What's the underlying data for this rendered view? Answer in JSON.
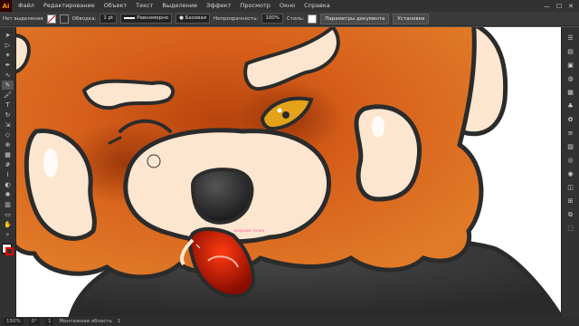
{
  "app": {
    "logo": "Ai"
  },
  "menubar": {
    "items": [
      "Файл",
      "Редактирование",
      "Объект",
      "Текст",
      "Выделение",
      "Эффект",
      "Просмотр",
      "Окно",
      "Справка"
    ],
    "window_controls": [
      "minimize-icon",
      "maximize-icon",
      "close-icon"
    ]
  },
  "controlbar": {
    "selection_label": "Нет выделения",
    "stroke_label": "Обводка:",
    "stroke_weight": "1 pt",
    "profile": "Равномерно",
    "brush": "Базовая",
    "opacity_label": "Непрозрачность:",
    "opacity_value": "100%",
    "style_label": "Стиль:",
    "doc_settings_button": "Параметры документа",
    "preferences_button": "Установки"
  },
  "canvas": {
    "cursor_hint": "якорная точка",
    "colors": {
      "fur": "#d85f18",
      "muzzle": "#fde6cf",
      "outline": "#2b2b2b",
      "eye": "#e3a21a",
      "mouth": "#cc1a00",
      "body": "#3a3a3a"
    }
  },
  "toolbar": {
    "tools": [
      "selection-tool",
      "direct-selection-tool",
      "magic-wand-tool",
      "pen-tool",
      "curvature-tool",
      "pencil-tool",
      "paintbrush-tool",
      "type-tool",
      "rotate-tool",
      "scale-tool",
      "eraser-tool",
      "shape-builder-tool",
      "gradient-tool",
      "mesh-tool",
      "eyedropper-tool",
      "blend-tool",
      "symbol-sprayer-tool",
      "column-graph-tool",
      "artboard-tool",
      "hand-tool",
      "zoom-tool"
    ]
  },
  "rightpanel": {
    "icons": [
      "properties-icon",
      "layers-icon",
      "libraries-icon",
      "color-icon",
      "swatches-icon",
      "brushes-icon",
      "symbols-icon",
      "stroke-icon",
      "gradient-icon",
      "transparency-icon",
      "appearance-icon",
      "graphic-styles-icon",
      "align-icon",
      "pathfinder-icon",
      "transform-icon"
    ]
  },
  "statusbar": {
    "zoom": "150%",
    "rotation": "0°",
    "artboard_number": "1",
    "mode": "Монтажная область",
    "progress": "1"
  }
}
